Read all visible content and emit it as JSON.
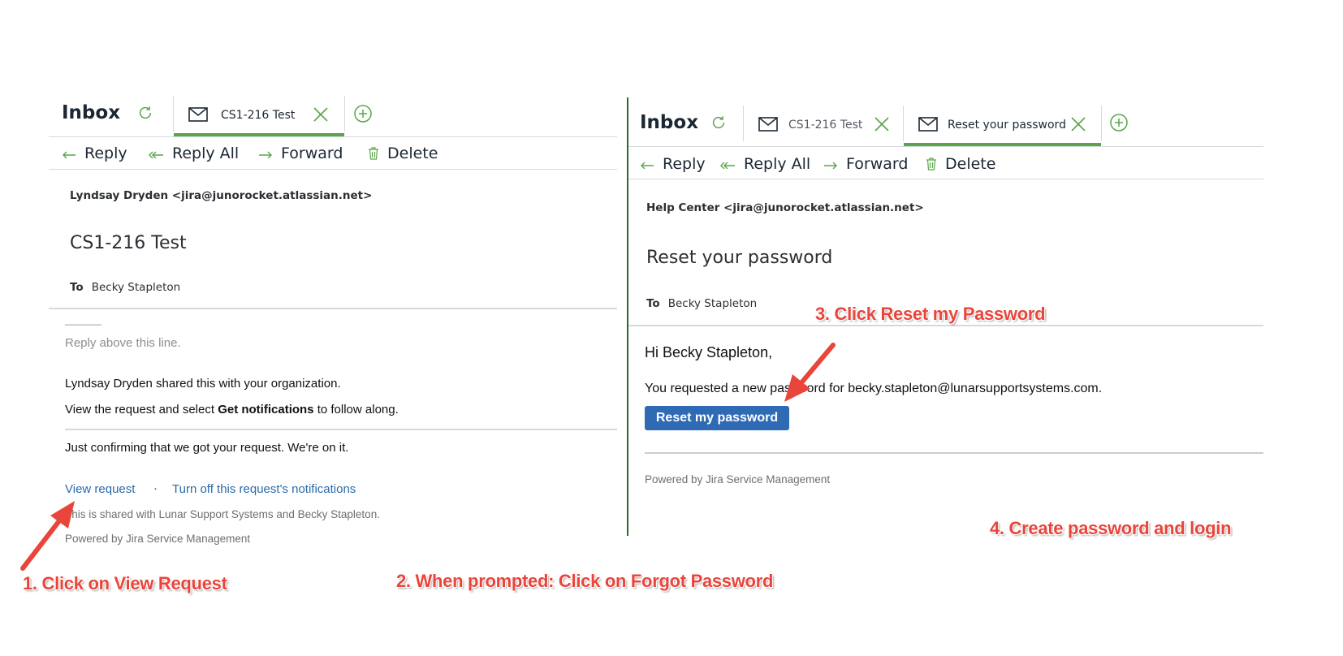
{
  "left_pane": {
    "inbox_title": "Inbox",
    "tab": {
      "label": "CS1-216 Test",
      "active": true
    },
    "toolbar": {
      "reply": "Reply",
      "reply_all": "Reply All",
      "forward": "Forward",
      "delete": "Delete"
    },
    "sender": "Lyndsay Dryden <jira@junorocket.atlassian.net>",
    "subject": "CS1-216 Test",
    "to_label": "To",
    "to_value": "Becky Stapleton",
    "reply_marker": "————",
    "reply_above": "Reply above this line.",
    "shared_line": "Lyndsay Dryden shared this with your organization.",
    "view_line_pre": "View the request and select ",
    "view_line_bold": "Get notifications",
    "view_line_post": " to follow along.",
    "confirm_line": "Just confirming that we got your request. We're on it.",
    "link_view_request": "View request",
    "link_separator": "·",
    "link_turn_off": "Turn off this request's notifications",
    "shared_with": "This is shared with Lunar Support Systems and Becky Stapleton.",
    "powered_by": "Powered by Jira Service Management"
  },
  "right_pane": {
    "inbox_title": "Inbox",
    "tabs": [
      {
        "label": "CS1-216 Test",
        "active": false
      },
      {
        "label": "Reset your password",
        "active": true
      }
    ],
    "toolbar": {
      "reply": "Reply",
      "reply_all": "Reply All",
      "forward": "Forward",
      "delete": "Delete"
    },
    "sender": "Help Center <jira@junorocket.atlassian.net>",
    "subject": "Reset your password",
    "to_label": "To",
    "to_value": "Becky Stapleton",
    "greeting": "Hi Becky Stapleton,",
    "requested_line": "You requested a new password for becky.stapleton@lunarsupportsystems.com.",
    "reset_button": "Reset my password",
    "powered_by": "Powered by Jira Service Management"
  },
  "annotations": {
    "step1": "1. Click on  View Request",
    "step2": "2. When prompted: Click on Forgot Password",
    "step3": "3. Click Reset my Password",
    "step4": "4. Create password and login"
  },
  "colors": {
    "accent_green": "#5aa54a",
    "link_blue": "#2c6aa8",
    "button_blue": "#2f6ab4",
    "annotation_red": "#e9453b"
  }
}
